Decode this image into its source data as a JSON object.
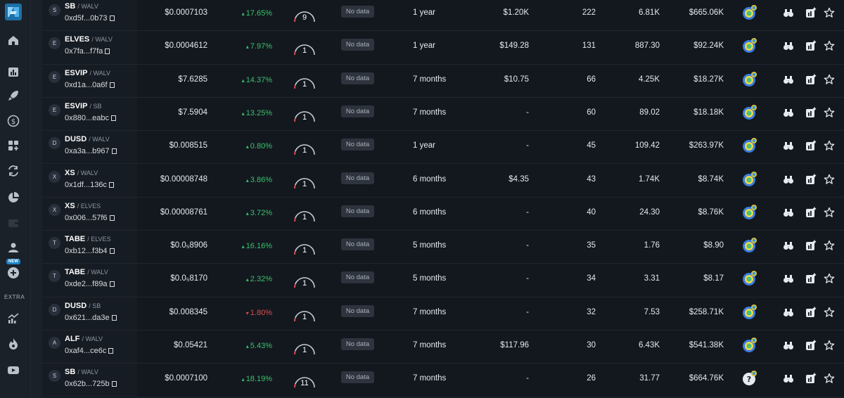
{
  "sidebar": {
    "logo": "app-logo",
    "items": [
      {
        "icon": "home-icon"
      },
      {
        "icon": "bar-chart-icon"
      },
      {
        "icon": "rocket-icon"
      },
      {
        "icon": "dollar-icon"
      },
      {
        "icon": "grid-plus-icon"
      },
      {
        "icon": "swap-icon"
      },
      {
        "icon": "pie-chart-icon"
      },
      {
        "icon": "wallet-icon"
      },
      {
        "icon": "user-icon"
      },
      {
        "icon": "plus-circle-icon"
      },
      {
        "icon": "trending-icon"
      },
      {
        "icon": "fire-icon"
      },
      {
        "icon": "youtube-icon"
      }
    ],
    "new_badge": "NEW",
    "extra_label": "EXTRA"
  },
  "colors": {
    "background": "#13181f",
    "sidebar": "#1b2129",
    "positive": "#3ac26b",
    "negative": "#e04b4b",
    "badge": "#2d343d"
  },
  "rows": [
    {
      "initial": "S",
      "base": "SB",
      "quote": "WALV",
      "address": "0xd5f...0b73",
      "price": "$0.0007103",
      "change": "17.65%",
      "dir": "up",
      "gauge": "9",
      "badge": "No data",
      "age": "1 year",
      "liquidity": "$1.20K",
      "holders": "222",
      "volume": "6.81K",
      "mcap": "$665.06K",
      "score_icon": "score-badge-icon"
    },
    {
      "initial": "E",
      "base": "ELVES",
      "quote": "WALV",
      "address": "0x7fa...f7fa",
      "price": "$0.0004612",
      "change": "7.97%",
      "dir": "up",
      "gauge": "1",
      "badge": "No data",
      "age": "1 year",
      "liquidity": "$149.28",
      "holders": "131",
      "volume": "887.30",
      "mcap": "$92.24K",
      "score_icon": "score-badge-icon"
    },
    {
      "initial": "E",
      "base": "ESVIP",
      "quote": "WALV",
      "address": "0xd1a...0a6f",
      "price": "$7.6285",
      "change": "14.37%",
      "dir": "up",
      "gauge": "1",
      "badge": "No data",
      "age": "7 months",
      "liquidity": "$10.75",
      "holders": "66",
      "volume": "4.25K",
      "mcap": "$18.27K",
      "score_icon": "score-badge-icon"
    },
    {
      "initial": "E",
      "base": "ESVIP",
      "quote": "SB",
      "address": "0x880...eabc",
      "price": "$7.5904",
      "change": "13.25%",
      "dir": "up",
      "gauge": "1",
      "badge": "No data",
      "age": "7 months",
      "liquidity": "-",
      "holders": "60",
      "volume": "89.02",
      "mcap": "$18.18K",
      "score_icon": "score-badge-icon"
    },
    {
      "initial": "D",
      "base": "DUSD",
      "quote": "WALV",
      "address": "0xa3a...b967",
      "price": "$0.008515",
      "change": "0.80%",
      "dir": "up",
      "gauge": "1",
      "badge": "No data",
      "age": "1 year",
      "liquidity": "-",
      "holders": "45",
      "volume": "109.42",
      "mcap": "$263.97K",
      "score_icon": "score-badge-icon"
    },
    {
      "initial": "X",
      "base": "XS",
      "quote": "WALV",
      "address": "0x1df...136c",
      "price": "$0.00008748",
      "change": "3.86%",
      "dir": "up",
      "gauge": "1",
      "badge": "No data",
      "age": "6 months",
      "liquidity": "$4.35",
      "holders": "43",
      "volume": "1.74K",
      "mcap": "$8.74K",
      "score_icon": "score-badge-icon"
    },
    {
      "initial": "X",
      "base": "XS",
      "quote": "ELVES",
      "address": "0x006...57f6",
      "price": "$0.00008761",
      "change": "3.72%",
      "dir": "up",
      "gauge": "1",
      "badge": "No data",
      "age": "6 months",
      "liquidity": "-",
      "holders": "40",
      "volume": "24.30",
      "mcap": "$8.76K",
      "score_icon": "score-badge-icon"
    },
    {
      "initial": "T",
      "base": "TABE",
      "quote": "ELVES",
      "address": "0xb12...f3b4",
      "price": "$0.0₅8906",
      "change": "16.16%",
      "dir": "up",
      "gauge": "1",
      "badge": "No data",
      "age": "5 months",
      "liquidity": "-",
      "holders": "35",
      "volume": "1.76",
      "mcap": "$8.90",
      "score_icon": "score-badge-icon"
    },
    {
      "initial": "T",
      "base": "TABE",
      "quote": "WALV",
      "address": "0xde2...f89a",
      "price": "$0.0₅8170",
      "change": "2.32%",
      "dir": "up",
      "gauge": "1",
      "badge": "No data",
      "age": "5 months",
      "liquidity": "-",
      "holders": "34",
      "volume": "3.31",
      "mcap": "$8.17",
      "score_icon": "score-badge-icon"
    },
    {
      "initial": "D",
      "base": "DUSD",
      "quote": "SB",
      "address": "0x621...da3e",
      "price": "$0.008345",
      "change": "1.80%",
      "dir": "down",
      "gauge": "1",
      "badge": "No data",
      "age": "7 months",
      "liquidity": "-",
      "holders": "32",
      "volume": "7.53",
      "mcap": "$258.71K",
      "score_icon": "score-badge-icon"
    },
    {
      "initial": "A",
      "base": "ALF",
      "quote": "WALV",
      "address": "0xaf4...ce6c",
      "price": "$0.05421",
      "change": "5.43%",
      "dir": "up",
      "gauge": "1",
      "badge": "No data",
      "age": "7 months",
      "liquidity": "$117.96",
      "holders": "30",
      "volume": "6.43K",
      "mcap": "$541.38K",
      "score_icon": "score-badge-icon"
    },
    {
      "initial": "S",
      "base": "SB",
      "quote": "WALV",
      "address": "0x62b...725b",
      "price": "$0.0007100",
      "change": "18.19%",
      "dir": "up",
      "gauge": "11",
      "badge": "No data",
      "age": "7 months",
      "liquidity": "-",
      "holders": "26",
      "volume": "31.77",
      "mcap": "$664.76K",
      "score_icon": "unknown-score-icon"
    }
  ]
}
